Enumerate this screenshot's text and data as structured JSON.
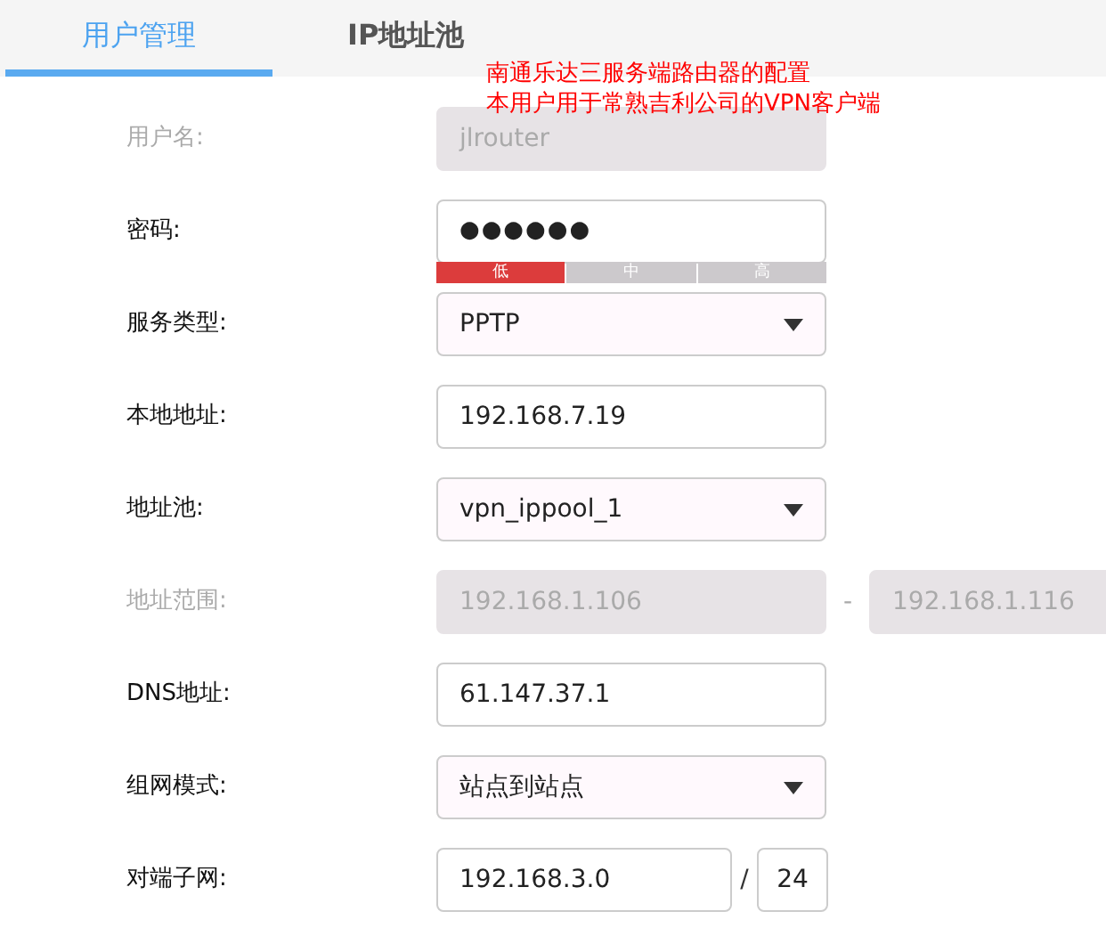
{
  "tabs": [
    {
      "label": "用户管理",
      "selected": true
    },
    {
      "label": "IP地址池",
      "selected": false
    }
  ],
  "annotation": [
    "南通乐达三服务端路由器的配置",
    "本用户用于常熟吉利公司的VPN客户端"
  ],
  "fields": [
    {
      "kind": "text",
      "label": "用户名:",
      "value": "jlrouter",
      "disabled": true
    },
    {
      "kind": "password",
      "label": "密码:",
      "value": "●●●●●●",
      "disabled": false,
      "strength": [
        {
          "label": "低",
          "on": true
        },
        {
          "label": "中",
          "on": false
        },
        {
          "label": "高",
          "on": false
        }
      ]
    },
    {
      "kind": "select",
      "label": "服务类型:",
      "value": "PPTP",
      "disabled": false
    },
    {
      "kind": "text",
      "label": "本地地址:",
      "value": "192.168.7.19",
      "disabled": false
    },
    {
      "kind": "select",
      "label": "地址池:",
      "value": "vpn_ippool_1",
      "disabled": false
    },
    {
      "kind": "range",
      "label": "地址范围:",
      "value": "192.168.1.106",
      "separator": "-",
      "value2": "192.168.1.116",
      "disabled": true
    },
    {
      "kind": "text",
      "label": "DNS地址:",
      "value": "61.147.37.1",
      "disabled": false
    },
    {
      "kind": "select",
      "label": "组网模式:",
      "value": "站点到站点",
      "disabled": false
    },
    {
      "kind": "subnet",
      "label": "对端子网:",
      "value": "192.168.3.0",
      "separator": "/",
      "value2": "24",
      "disabled": false
    }
  ]
}
